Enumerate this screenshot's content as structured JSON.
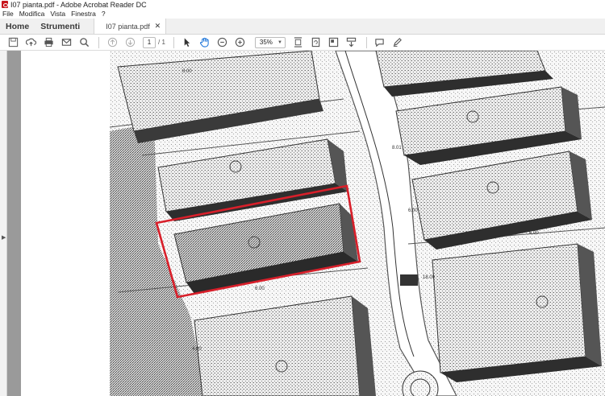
{
  "window": {
    "title": "I07 pianta.pdf - Adobe Acrobat Reader DC"
  },
  "menu": {
    "items": [
      "File",
      "Modifica",
      "Vista",
      "Finestra",
      "?"
    ]
  },
  "tabs": {
    "home": "Home",
    "tools": "Strumenti",
    "document": "I07 pianta.pdf"
  },
  "toolbar": {
    "page_current": "1",
    "page_total": "/ 1",
    "zoom": "35%"
  },
  "plan": {
    "labels": [
      "8.00",
      "8.01",
      "6.00",
      "18.00",
      "6.00",
      "6.00",
      "4.00"
    ],
    "highlight_color": "#d81f2a"
  }
}
